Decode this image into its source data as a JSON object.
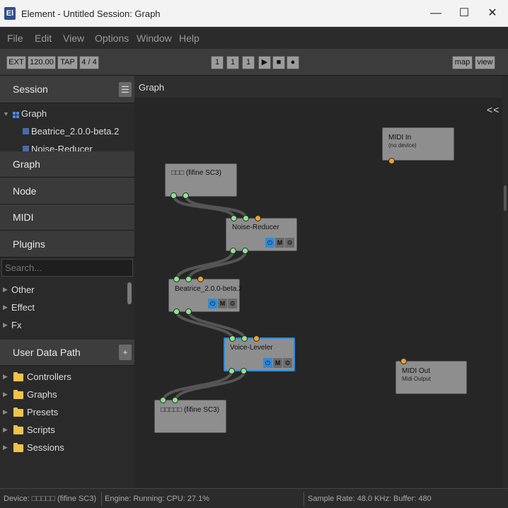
{
  "window": {
    "app_icon_text": "El",
    "title": "Element - Untitled Session: Graph",
    "minimize": "—",
    "maximize": "☐",
    "close": "✕"
  },
  "menu": [
    "File",
    "Edit",
    "View",
    "Options",
    "Window",
    "Help"
  ],
  "toolbar": {
    "ext": "EXT",
    "tempo": "120.00",
    "tap": "TAP",
    "meter": "4 / 4",
    "pos_bar": "1",
    "pos_beat": "1",
    "pos_tick": "1",
    "play": "▶",
    "stop": "■",
    "record": "●",
    "map": "map",
    "view": "view"
  },
  "sidebar": {
    "session": {
      "title": "Session",
      "menu_icon": "☰",
      "tree": {
        "root": "Graph",
        "children": [
          "Beatrice_2.0.0-beta.2",
          "Noise-Reducer"
        ]
      }
    },
    "sections": [
      "Graph",
      "Node",
      "MIDI",
      "Plugins"
    ],
    "search": {
      "placeholder": "Search..."
    },
    "plugin_categories": [
      "Other",
      "Effect",
      "Fx"
    ],
    "user_data": {
      "title": "User Data Path",
      "add": "+",
      "folders": [
        "Controllers",
        "Graphs",
        "Presets",
        "Scripts",
        "Sessions"
      ]
    }
  },
  "graph": {
    "title": "Graph",
    "collapse": "<<",
    "nodes": {
      "midi_in": {
        "title": "MIDI In",
        "subtitle": "(no device)"
      },
      "audio_in": {
        "title": "□□□ (fifine SC3)"
      },
      "noise_reducer": {
        "title": "Noise-Reducer"
      },
      "beatrice": {
        "title": "Beatrice_2.0.0-beta.2"
      },
      "voice_leveler": {
        "title": "Voice-Leveler"
      },
      "midi_out": {
        "title": "MIDI Out",
        "subtitle": "Midi Output"
      },
      "audio_out": {
        "title": "□□□□□ (fifine SC3)"
      }
    },
    "node_buttons": {
      "power": "⏻",
      "mute": "M",
      "settings": "⚙"
    }
  },
  "status": {
    "device": "Device: □□□□□ (fifine SC3)",
    "engine": "Engine: Running:  CPU: 27.1%",
    "sample": "Sample Rate: 48.0 KHz:  Buffer: 480"
  },
  "colors": {
    "accent": "#2f8ad8",
    "audio_port": "#8ee38e",
    "midi_port": "#f0a030",
    "folder": "#f0c24c"
  }
}
